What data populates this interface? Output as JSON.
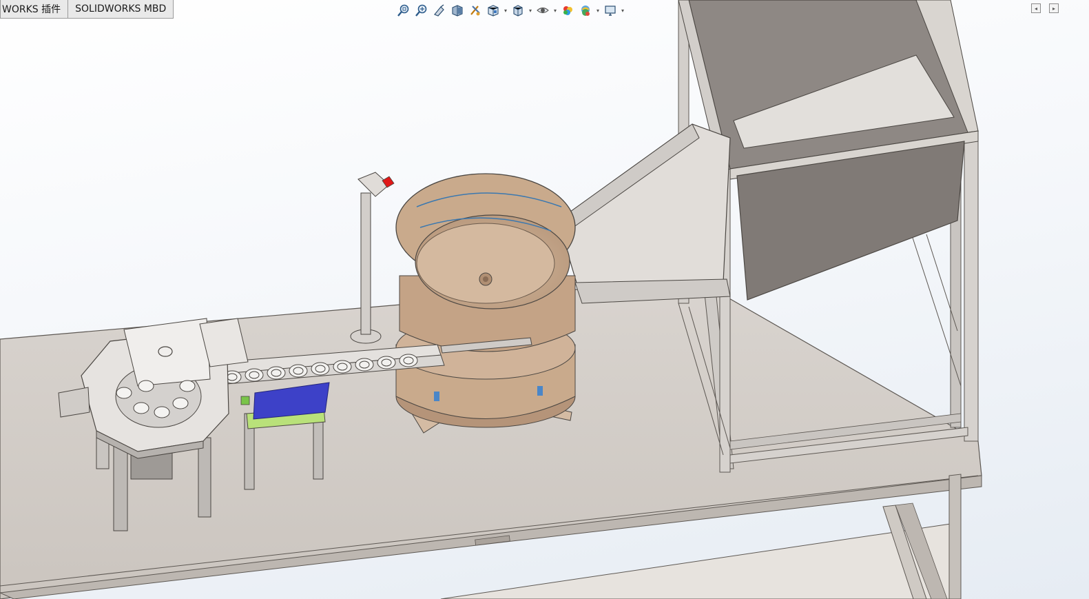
{
  "tabs": [
    {
      "label": "WORKS 插件"
    },
    {
      "label": "SOLIDWORKS MBD"
    }
  ],
  "heads_up_toolbar": {
    "tools": [
      {
        "icon": "zoom-to-fit-icon"
      },
      {
        "icon": "zoom-to-area-icon"
      },
      {
        "icon": "previous-view-icon"
      },
      {
        "icon": "section-view-icon"
      },
      {
        "icon": "dynamic-annotation-views-icon"
      },
      {
        "icon": "view-orientation-icon",
        "dropdown": true
      },
      {
        "icon": "display-style-icon",
        "dropdown": true
      },
      {
        "icon": "hide-show-items-icon",
        "dropdown": true
      },
      {
        "icon": "edit-appearance-icon"
      },
      {
        "icon": "apply-scene-icon",
        "dropdown": true
      },
      {
        "icon": "view-settings-icon",
        "dropdown": true
      }
    ],
    "dropdown_glyph": "▾"
  },
  "window_controls": [
    {
      "icon": "collapse-left-pane-icon",
      "glyph": "◂"
    },
    {
      "icon": "collapse-right-pane-icon",
      "glyph": "▸"
    }
  ],
  "colors": {
    "table_top": "#d8d3cd",
    "frame": "#c9c5c1",
    "bowl": "#c9aa8c",
    "bowl_dark": "#b59479",
    "hopper": "#8d8783",
    "plate_blue": "#3d41c8",
    "plate_green": "#b9e17a",
    "marker_red": "#e01818"
  }
}
